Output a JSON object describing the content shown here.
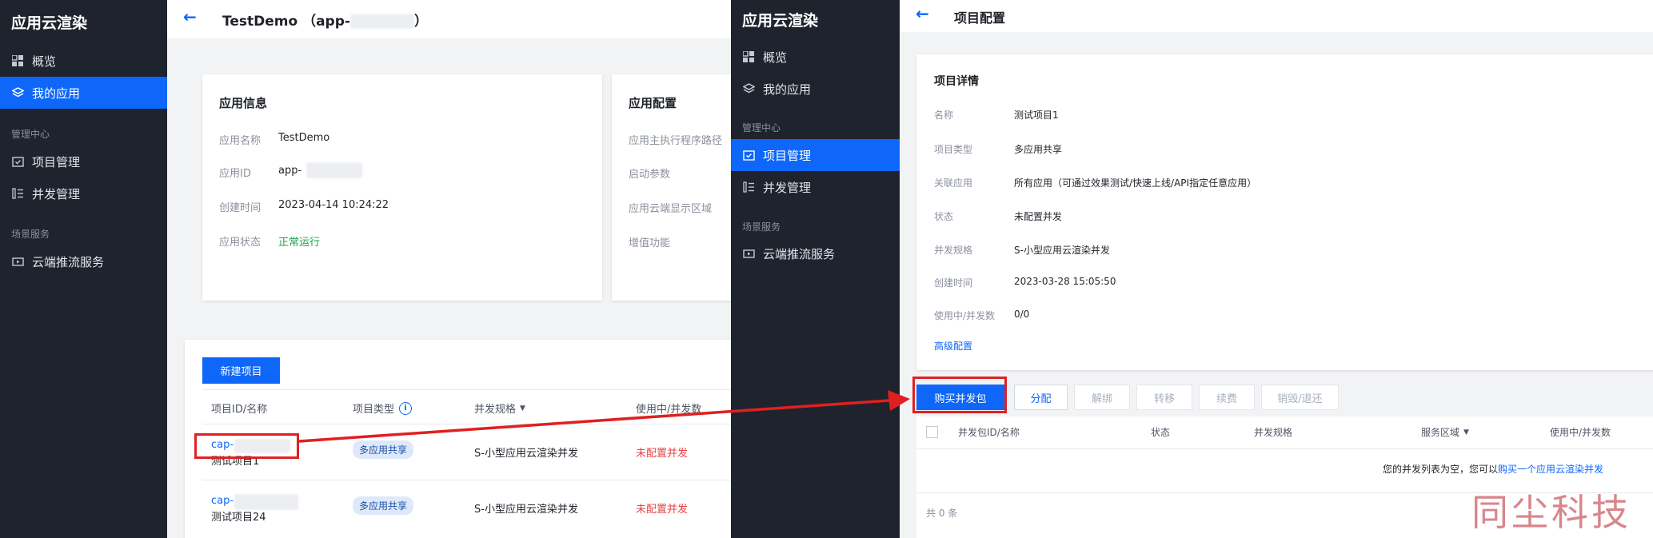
{
  "left_sidebar": {
    "title": "应用云渲染",
    "items": [
      {
        "label": "概览",
        "icon": "grid-icon"
      },
      {
        "label": "我的应用",
        "icon": "layers-icon",
        "active": true
      }
    ],
    "group1": "管理中心",
    "group1_items": [
      {
        "label": "项目管理",
        "icon": "folder-check-icon"
      },
      {
        "label": "并发管理",
        "icon": "list-icon"
      }
    ],
    "group2": "场景服务",
    "group2_items": [
      {
        "label": "云端推流服务",
        "icon": "video-icon"
      }
    ]
  },
  "left_main": {
    "back": "←",
    "title": "TestDemo （app-",
    "title_suffix": "）",
    "app_info": {
      "title": "应用信息",
      "rows": [
        {
          "label": "应用名称",
          "value": "TestDemo"
        },
        {
          "label": "应用ID",
          "value": "app-"
        },
        {
          "label": "创建时间",
          "value": "2023-04-14 10:24:22"
        },
        {
          "label": "应用状态",
          "value": "正常运行"
        }
      ]
    },
    "app_config": {
      "title": "应用配置",
      "rows": [
        "应用主执行程序路径",
        "启动参数",
        "应用云端显示区域",
        "增值功能"
      ]
    },
    "new_project_button": "新建项目",
    "table": {
      "headers": [
        "项目ID/名称",
        "项目类型",
        "并发规格",
        "使用中/并发数"
      ],
      "info_icon": "i",
      "filter_icon": "▼",
      "rows": [
        {
          "id": "cap-",
          "name": "测试项目1",
          "type": "多应用共享",
          "spec": "S-小型应用云渲染并发",
          "status": "未配置并发"
        },
        {
          "id": "cap-",
          "name": "测试项目24",
          "type": "多应用共享",
          "spec": "S-小型应用云渲染并发",
          "status": "未配置并发"
        }
      ]
    }
  },
  "right_sidebar": {
    "title": "应用云渲染",
    "items": [
      {
        "label": "概览",
        "icon": "grid-icon"
      },
      {
        "label": "我的应用",
        "icon": "layers-icon"
      }
    ],
    "group1": "管理中心",
    "group1_items": [
      {
        "label": "项目管理",
        "icon": "folder-check-icon",
        "active": true
      },
      {
        "label": "并发管理",
        "icon": "list-icon"
      }
    ],
    "group2": "场景服务",
    "group2_items": [
      {
        "label": "云端推流服务",
        "icon": "video-icon"
      }
    ]
  },
  "right_main": {
    "back": "←",
    "title": "项目配置",
    "details": {
      "title": "项目详情",
      "rows": [
        {
          "label": "名称",
          "value": "测试项目1"
        },
        {
          "label": "项目类型",
          "value": "多应用共享"
        },
        {
          "label": "关联应用",
          "value": "所有应用（可通过效果测试/快速上线/API指定任意应用）"
        },
        {
          "label": "状态",
          "value": "未配置并发"
        },
        {
          "label": "并发规格",
          "value": "S-小型应用云渲染并发"
        },
        {
          "label": "创建时间",
          "value": "2023-03-28 15:05:50"
        },
        {
          "label": "使用中/并发数",
          "value": "0/0"
        }
      ],
      "advanced": "高级配置"
    },
    "buttons": {
      "buy": "购买并发包",
      "assign": "分配",
      "unbind": "解绑",
      "transfer": "转移",
      "renew": "续费",
      "destroy": "销毁/退还"
    },
    "table": {
      "headers": [
        "并发包ID/名称",
        "状态",
        "并发规格",
        "服务区域",
        "使用中/并发数"
      ],
      "filter_icon": "▼",
      "empty_text": "您的并发列表为空，您可以",
      "empty_link": "购买一个应用云渲染并发",
      "total": "共 0 条"
    }
  },
  "watermark": "同尘科技",
  "colors": {
    "primary": "#0e67f8",
    "sidebar": "#1f232e",
    "highlight": "#e02020"
  }
}
